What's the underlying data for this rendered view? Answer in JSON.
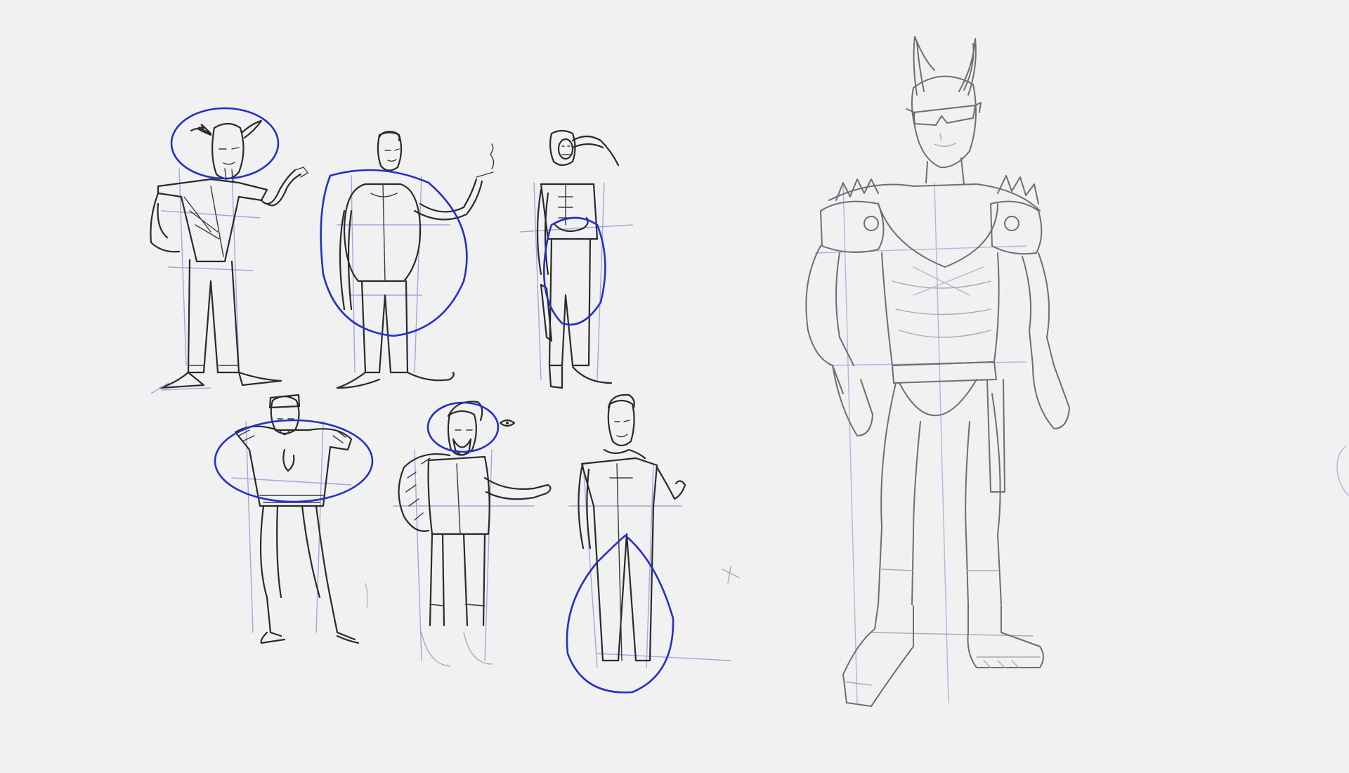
{
  "canvas": {
    "background": "#f1f1f1",
    "ink_color": "#2a2a2a",
    "construction_color": "#9d95d8",
    "highlight_circle_color": "#2530c8",
    "pencil_color": "#6e6e72"
  },
  "sketches": [
    {
      "name": "horned-man-in-suit",
      "row": 1,
      "position": 1,
      "highlight": "head"
    },
    {
      "name": "slender-man-with-cigarette",
      "row": 1,
      "position": 2,
      "highlight": "torso"
    },
    {
      "name": "skull-mask-man-with-sword",
      "row": 1,
      "position": 3,
      "highlight": "hips"
    },
    {
      "name": "hunched-officer-with-epaulettes",
      "row": 2,
      "position": 1,
      "highlight": "shoulders"
    },
    {
      "name": "bearded-man-with-fur-collar",
      "row": 2,
      "position": 2,
      "highlight": "head"
    },
    {
      "name": "man-in-long-coat",
      "row": 2,
      "position": 3,
      "highlight": "coat-hem"
    }
  ],
  "final_figure": {
    "name": "horned-demon-with-sunglasses",
    "details": [
      "horns",
      "sunglasses",
      "spiked-shoulder-pads",
      "loincloth-belt",
      "platform-boots"
    ]
  }
}
